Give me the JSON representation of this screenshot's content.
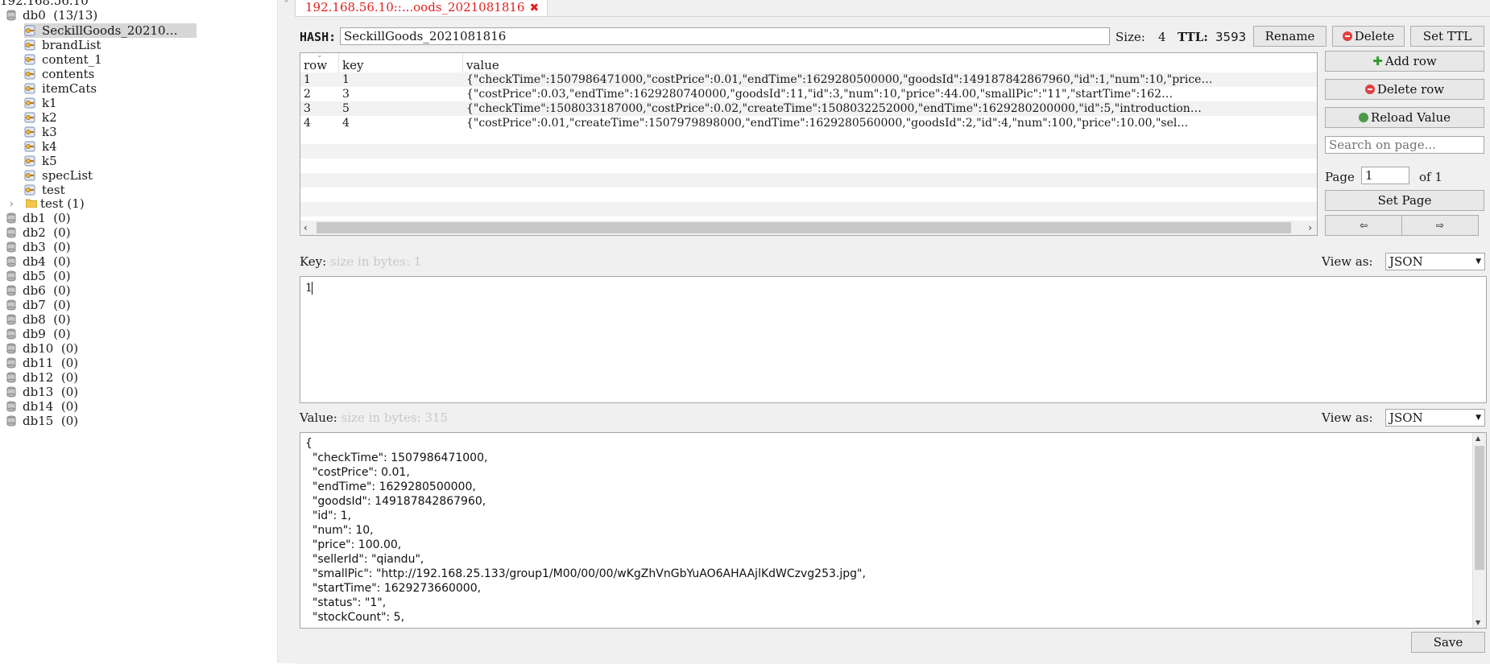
{
  "tree": {
    "host": "192.168.56.10",
    "db0": {
      "name": "db0",
      "count": "(13/13)"
    },
    "keys": [
      "SeckillGoods_20210…",
      "brandList",
      "content_1",
      "contents",
      "itemCats",
      "k1",
      "k2",
      "k3",
      "k4",
      "k5",
      "specList",
      "test"
    ],
    "folder": {
      "name": "test",
      "count": "(1)"
    },
    "dbs": [
      {
        "name": "db1",
        "count": "(0)"
      },
      {
        "name": "db2",
        "count": "(0)"
      },
      {
        "name": "db3",
        "count": "(0)"
      },
      {
        "name": "db4",
        "count": "(0)"
      },
      {
        "name": "db5",
        "count": "(0)"
      },
      {
        "name": "db6",
        "count": "(0)"
      },
      {
        "name": "db7",
        "count": "(0)"
      },
      {
        "name": "db8",
        "count": "(0)"
      },
      {
        "name": "db9",
        "count": "(0)"
      },
      {
        "name": "db10",
        "count": "(0)"
      },
      {
        "name": "db11",
        "count": "(0)"
      },
      {
        "name": "db12",
        "count": "(0)"
      },
      {
        "name": "db13",
        "count": "(0)"
      },
      {
        "name": "db14",
        "count": "(0)"
      },
      {
        "name": "db15",
        "count": "(0)"
      }
    ]
  },
  "tab": {
    "title": "192.168.56.10::...oods_2021081816"
  },
  "header": {
    "type_label": "HASH:",
    "key_name": "SeckillGoods_2021081816",
    "size_label": "Size:",
    "size_value": "4",
    "ttl_label": "TTL:",
    "ttl_value": "3593",
    "rename": "Rename",
    "delete": "Delete",
    "set_ttl": "Set TTL"
  },
  "table": {
    "columns": [
      "row",
      "key",
      "value"
    ],
    "rows": [
      {
        "row": "1",
        "key": "1",
        "value": "{\"checkTime\":1507986471000,\"costPrice\":0.01,\"endTime\":1629280500000,\"goodsId\":149187842867960,\"id\":1,\"num\":10,\"price…"
      },
      {
        "row": "2",
        "key": "3",
        "value": "{\"costPrice\":0.03,\"endTime\":1629280740000,\"goodsId\":11,\"id\":3,\"num\":10,\"price\":44.00,\"smallPic\":\"11\",\"startTime\":162…"
      },
      {
        "row": "3",
        "key": "5",
        "value": "{\"checkTime\":1508033187000,\"costPrice\":0.02,\"createTime\":1508032252000,\"endTime\":1629280200000,\"id\":5,\"introduction…"
      },
      {
        "row": "4",
        "key": "4",
        "value": "{\"costPrice\":0.01,\"createTime\":1507979898000,\"endTime\":1629280560000,\"goodsId\":2,\"id\":4,\"num\":100,\"price\":10.00,\"sel…"
      }
    ]
  },
  "side": {
    "add_row": "Add row",
    "delete_row": "Delete row",
    "reload": "Reload Value",
    "search_placeholder": "Search on page...",
    "page_label": "Page",
    "page_value": "1",
    "of_label": "of 1",
    "set_page": "Set Page",
    "prev": "⇦",
    "next": "⇨"
  },
  "key_editor": {
    "label": "Key:",
    "hint": "size in bytes: 1",
    "view_as": "View as:",
    "format": "JSON",
    "value": "1"
  },
  "value_editor": {
    "label": "Value:",
    "hint": "size in bytes: 315",
    "view_as": "View as:",
    "format": "JSON",
    "text": "{\n  \"checkTime\": 1507986471000,\n  \"costPrice\": 0.01,\n  \"endTime\": 1629280500000,\n  \"goodsId\": 149187842867960,\n  \"id\": 1,\n  \"num\": 10,\n  \"price\": 100.00,\n  \"sellerId\": \"qiandu\",\n  \"smallPic\": \"http://192.168.25.133/group1/M00/00/00/wKgZhVnGbYuAO6AHAAjlKdWCzvg253.jpg\",\n  \"startTime\": 1629273660000,\n  \"status\": \"1\",\n  \"stockCount\": 5,"
  },
  "save": "Save"
}
